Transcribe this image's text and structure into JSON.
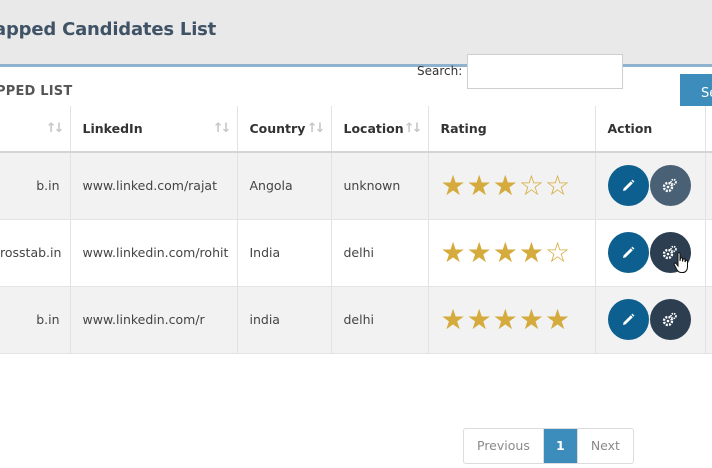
{
  "page": {
    "title": "apped Candidates List"
  },
  "card": {
    "title": "PPED LIST",
    "head_button": "Se"
  },
  "search": {
    "label": "Search:",
    "value": "",
    "placeholder": ""
  },
  "table": {
    "columns": [
      "",
      "LinkedIn",
      "Country",
      "Location",
      "Rating",
      "Action"
    ],
    "rows": [
      {
        "email": "b.in",
        "linkedin": "www.linked.com/rajat",
        "country": "Angola",
        "location": "unknown",
        "rating": 3,
        "max_rating": 5
      },
      {
        "email": "rosstab.in",
        "linkedin": "www.linkedin.com/rohit",
        "country": "India",
        "location": "delhi",
        "rating": 4,
        "max_rating": 5
      },
      {
        "email": "b.in",
        "linkedin": "www.linkedin.com/r",
        "country": "india",
        "location": "delhi",
        "rating": 5,
        "max_rating": 5
      }
    ]
  },
  "pagination": {
    "previous": "Previous",
    "current": "1",
    "next": "Next"
  },
  "icons": {
    "edit": "pencil-icon",
    "settings": "gear-icon",
    "sort": "sort-icon",
    "cursor": "hand-pointer-icon"
  },
  "colors": {
    "primary": "#3c8dbc",
    "edit_button": "#0c5f8f",
    "settings_button": "#2c3e50",
    "star": "#d4ab3c",
    "title": "#3f5266"
  }
}
